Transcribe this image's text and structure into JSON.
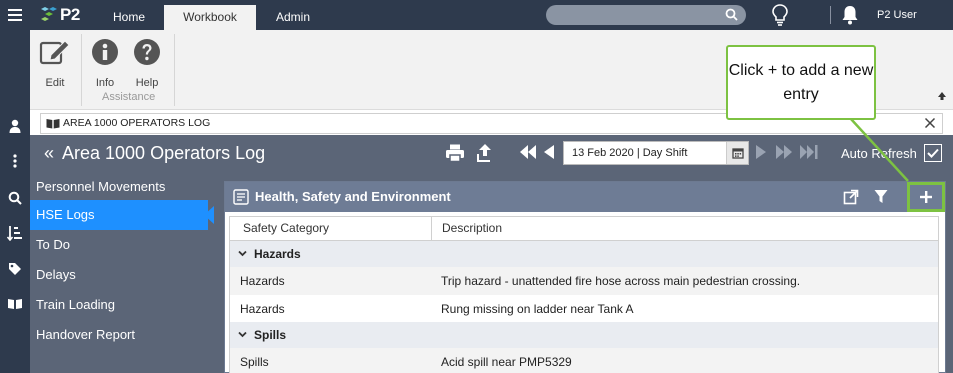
{
  "app": {
    "logo_text": "P2",
    "tabs": [
      {
        "label": "Home",
        "active": false
      },
      {
        "label": "Workbook",
        "active": true
      },
      {
        "label": "Admin",
        "active": false
      }
    ],
    "user_name": "P2 User"
  },
  "ribbon": {
    "edit_label": "Edit",
    "info_label": "Info",
    "help_label": "Help",
    "group_label": "Assistance"
  },
  "document": {
    "title": "AREA 1000 OPERATORS LOG"
  },
  "header": {
    "page_title": "Area 1000 Operators Log",
    "shift_value": "13 Feb 2020 | Day Shift",
    "auto_refresh_label": "Auto Refresh",
    "auto_refresh_checked": true
  },
  "nav": {
    "items": [
      {
        "label": "Personnel Movements",
        "active": false
      },
      {
        "label": "HSE Logs",
        "active": true
      },
      {
        "label": "To Do",
        "active": false
      },
      {
        "label": "Delays",
        "active": false
      },
      {
        "label": "Train Loading",
        "active": false
      },
      {
        "label": "Handover Report",
        "active": false
      }
    ]
  },
  "panel": {
    "title": "Health, Safety and Environment",
    "columns": [
      "Safety Category",
      "Description"
    ],
    "groups": [
      {
        "name": "Hazards",
        "rows": [
          {
            "category": "Hazards",
            "description": "Trip hazard - unattended fire hose across main pedestrian crossing."
          },
          {
            "category": "Hazards",
            "description": "Rung missing on ladder near Tank A"
          }
        ]
      },
      {
        "name": "Spills",
        "rows": [
          {
            "category": "Spills",
            "description": "Acid spill near PMP5329"
          }
        ]
      }
    ]
  },
  "callout": {
    "text": "Click + to add a new entry"
  },
  "colors": {
    "topbar": "#2e3a4d",
    "header": "#5b6577",
    "active_nav": "#1e90ff",
    "panel_header": "#6e7c95",
    "callout_border": "#7dc242"
  }
}
